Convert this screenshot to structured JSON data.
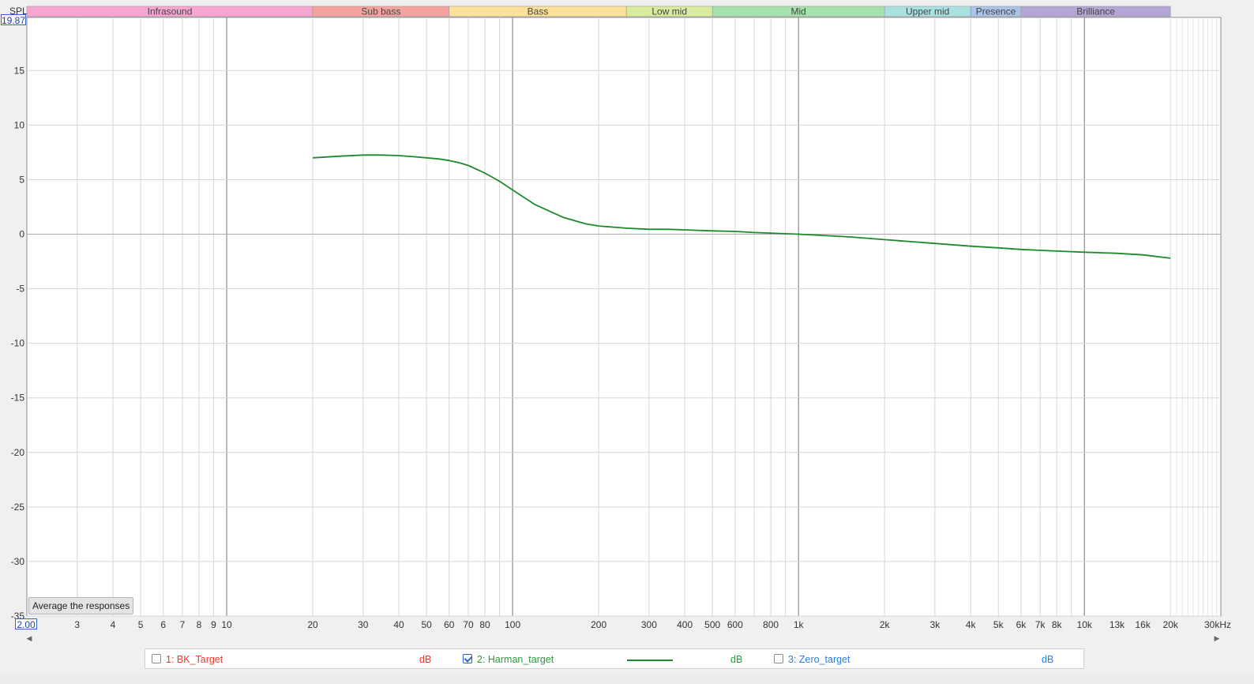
{
  "bands": [
    {
      "label": "Infrasound",
      "from": 2,
      "to": 20,
      "color": "#f7a6cf"
    },
    {
      "label": "Sub bass",
      "from": 20,
      "to": 60,
      "color": "#f4a39f"
    },
    {
      "label": "Bass",
      "from": 60,
      "to": 250,
      "color": "#fbe19a"
    },
    {
      "label": "Low mid",
      "from": 250,
      "to": 500,
      "color": "#d9eb9c"
    },
    {
      "label": "Mid",
      "from": 500,
      "to": 2000,
      "color": "#a5e2ad"
    },
    {
      "label": "Upper mid",
      "from": 2000,
      "to": 4000,
      "color": "#a8e1df"
    },
    {
      "label": "Presence",
      "from": 4000,
      "to": 6000,
      "color": "#abc3e8"
    },
    {
      "label": "Brilliance",
      "from": 6000,
      "to": 20000,
      "color": "#b3a6d6"
    }
  ],
  "y_axis": {
    "unit_label": "SPL",
    "top_value": "19.87",
    "ticks": [
      "15",
      "10",
      "5",
      "0",
      "-5",
      "-10",
      "-15",
      "-20",
      "-25",
      "-30",
      "-35"
    ]
  },
  "x_axis": {
    "start_value": "2.00",
    "unit_label": "30kHz",
    "ticks": [
      {
        "v": 3,
        "label": "3"
      },
      {
        "v": 4,
        "label": "4"
      },
      {
        "v": 5,
        "label": "5"
      },
      {
        "v": 6,
        "label": "6"
      },
      {
        "v": 7,
        "label": "7"
      },
      {
        "v": 8,
        "label": "8"
      },
      {
        "v": 9,
        "label": "9"
      },
      {
        "v": 10,
        "label": "10"
      },
      {
        "v": 20,
        "label": "20"
      },
      {
        "v": 30,
        "label": "30"
      },
      {
        "v": 40,
        "label": "40"
      },
      {
        "v": 50,
        "label": "50"
      },
      {
        "v": 60,
        "label": "60"
      },
      {
        "v": 70,
        "label": "70"
      },
      {
        "v": 80,
        "label": "80"
      },
      {
        "v": 100,
        "label": "100"
      },
      {
        "v": 200,
        "label": "200"
      },
      {
        "v": 300,
        "label": "300"
      },
      {
        "v": 400,
        "label": "400"
      },
      {
        "v": 500,
        "label": "500"
      },
      {
        "v": 600,
        "label": "600"
      },
      {
        "v": 800,
        "label": "800"
      },
      {
        "v": 1000,
        "label": "1k"
      },
      {
        "v": 2000,
        "label": "2k"
      },
      {
        "v": 3000,
        "label": "3k"
      },
      {
        "v": 4000,
        "label": "4k"
      },
      {
        "v": 5000,
        "label": "5k"
      },
      {
        "v": 6000,
        "label": "6k"
      },
      {
        "v": 7000,
        "label": "7k"
      },
      {
        "v": 8000,
        "label": "8k"
      },
      {
        "v": 10000,
        "label": "10k"
      },
      {
        "v": 13000,
        "label": "13k",
        "muted": true
      },
      {
        "v": 16000,
        "label": "16k",
        "muted": true
      },
      {
        "v": 20000,
        "label": "20k"
      }
    ]
  },
  "chart_data": {
    "type": "line",
    "xscale": "log",
    "xlim": [
      2,
      30000
    ],
    "ylim": [
      -35,
      19.87
    ],
    "grid": true,
    "series": [
      {
        "name": "2: Harman_target",
        "color": "#1f8a2c",
        "x": [
          20,
          25,
          30,
          35,
          40,
          45,
          50,
          55,
          60,
          65,
          70,
          80,
          90,
          100,
          120,
          150,
          180,
          200,
          250,
          300,
          350,
          400,
          500,
          600,
          700,
          800,
          1000,
          1500,
          2000,
          3000,
          4000,
          5000,
          6000,
          8000,
          10000,
          13000,
          16000,
          20000
        ],
        "y": [
          7.0,
          7.15,
          7.25,
          7.25,
          7.2,
          7.1,
          7.0,
          6.9,
          6.75,
          6.55,
          6.3,
          5.6,
          4.85,
          4.05,
          2.7,
          1.55,
          0.95,
          0.75,
          0.55,
          0.45,
          0.45,
          0.4,
          0.3,
          0.25,
          0.15,
          0.1,
          0.0,
          -0.25,
          -0.5,
          -0.85,
          -1.1,
          -1.25,
          -1.4,
          -1.55,
          -1.65,
          -1.75,
          -1.9,
          -2.2
        ]
      }
    ]
  },
  "average_button": "Average the responses",
  "legend": [
    {
      "name": "1: BK_Target",
      "unit": "dB",
      "checked": false,
      "color": "#e53b2d"
    },
    {
      "name": "2: Harman_target",
      "unit": "dB",
      "checked": true,
      "color": "#2a9a3a",
      "line_color": "#1f8a2c"
    },
    {
      "name": "3: Zero_target",
      "unit": "dB",
      "checked": false,
      "color": "#2b7fd6"
    }
  ]
}
